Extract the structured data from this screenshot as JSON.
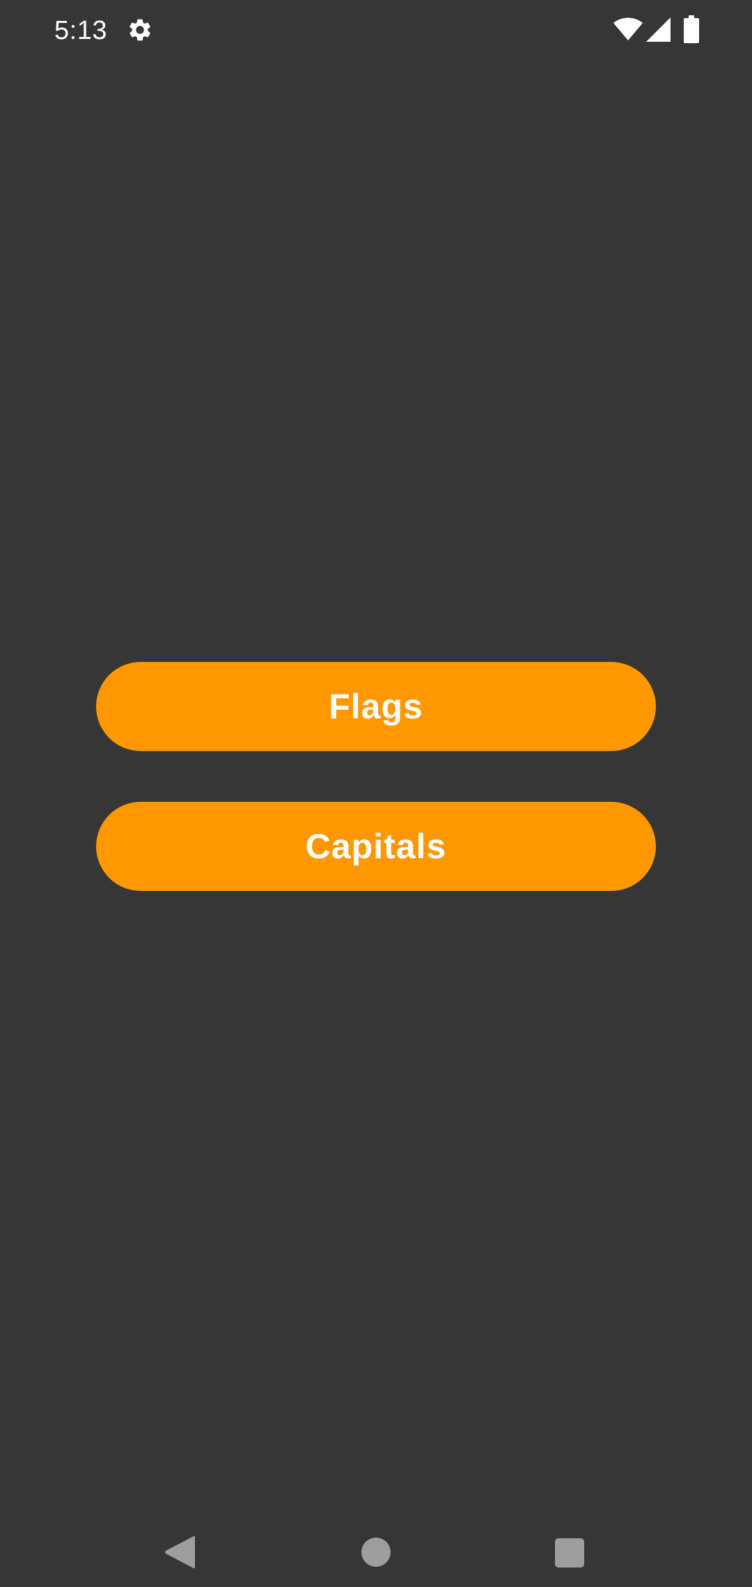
{
  "status_bar": {
    "time": "5:13",
    "icons": [
      "gear-icon",
      "wifi-icon",
      "cellular-signal-icon",
      "battery-icon"
    ]
  },
  "main": {
    "buttons": [
      {
        "label": "Flags"
      },
      {
        "label": "Capitals"
      }
    ]
  },
  "nav_bar": {
    "icons": [
      "back-icon",
      "home-icon",
      "recents-icon"
    ]
  },
  "colors": {
    "background": "#363636",
    "button": "#ff9800",
    "button_text": "#ffffff",
    "nav_icon": "#9e9e9e"
  }
}
